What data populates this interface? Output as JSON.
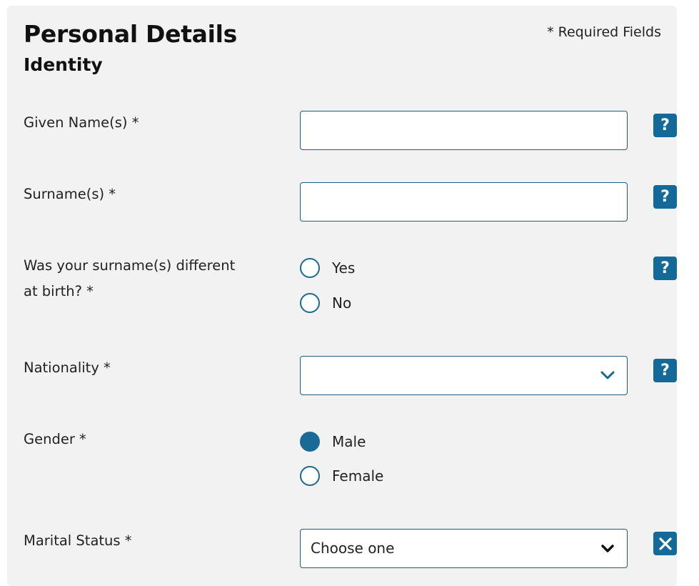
{
  "header": {
    "title": "Personal Details",
    "subtitle": "Identity",
    "required_note": "* Required Fields"
  },
  "fields": {
    "given_name": {
      "label": "Given Name(s) *",
      "value": ""
    },
    "surname": {
      "label": "Surname(s) *",
      "value": ""
    },
    "surname_birth": {
      "label": "Was your surname(s) different at birth? *",
      "options": [
        "Yes",
        "No"
      ],
      "selected": null
    },
    "nationality": {
      "label": "Nationality *",
      "value": ""
    },
    "gender": {
      "label": "Gender *",
      "options": [
        "Male",
        "Female"
      ],
      "selected": "Male"
    },
    "marital_status": {
      "label": "Marital Status *",
      "value": "Choose one"
    }
  },
  "help_icon_glyph": "?",
  "colors": {
    "accent": "#1a6a96",
    "help_button": "#136a98",
    "card_background": "#f2f2f2",
    "input_border": "#1f5c7e"
  }
}
